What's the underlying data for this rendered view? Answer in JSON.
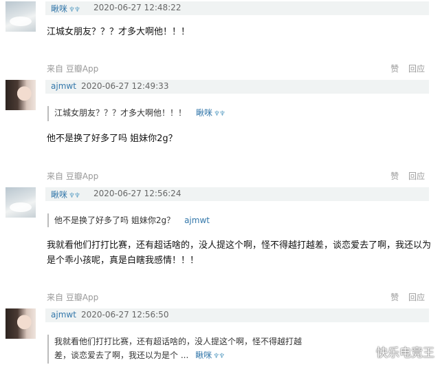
{
  "comments": [
    {
      "author": "瞅咪",
      "badges": "♆♆",
      "time": "2020-06-27 12:48:22",
      "text": "江城女朋友？？？才多大啊他！！！",
      "source": "来自 豆瓣App",
      "like": "赞",
      "reply": "回应"
    },
    {
      "author": "ajmwt",
      "time": "2020-06-27 12:49:33",
      "quote_text": "江城女朋友？？？才多大啊他！！！",
      "quote_author": "瞅咪",
      "quote_badges": "♆♆",
      "text": "他不是换了好多了吗 姐妹你2g？",
      "source": "来自 豆瓣App",
      "like": "赞",
      "reply": "回应"
    },
    {
      "author": "瞅咪",
      "badges": "♆♆",
      "time": "2020-06-27 12:56:24",
      "quote_text": "他不是换了好多了吗 姐妹你2g？",
      "quote_author": "ajmwt",
      "text_line1": "我就看他们打打比赛，还有超话啥的，没人提这个啊，怪不得越打越差，谈恋爱去了啊，我还以为",
      "text_line2": "是个乖小孩呢，真是白瞎我感情！！！",
      "source": "来自 豆瓣App",
      "like": "赞",
      "reply": "回应"
    },
    {
      "author": "ajmwt",
      "time": "2020-06-27 12:56:50",
      "quote_line1": "我就看他们打打比赛，还有超话啥的，没人提这个啊，怪不得越打越",
      "quote_line2": "差，谈恋爱去了啊，我还以为是个 ...",
      "quote_author": "瞅咪",
      "quote_badges": "♆♆"
    }
  ],
  "watermark": "快乐电竞王"
}
